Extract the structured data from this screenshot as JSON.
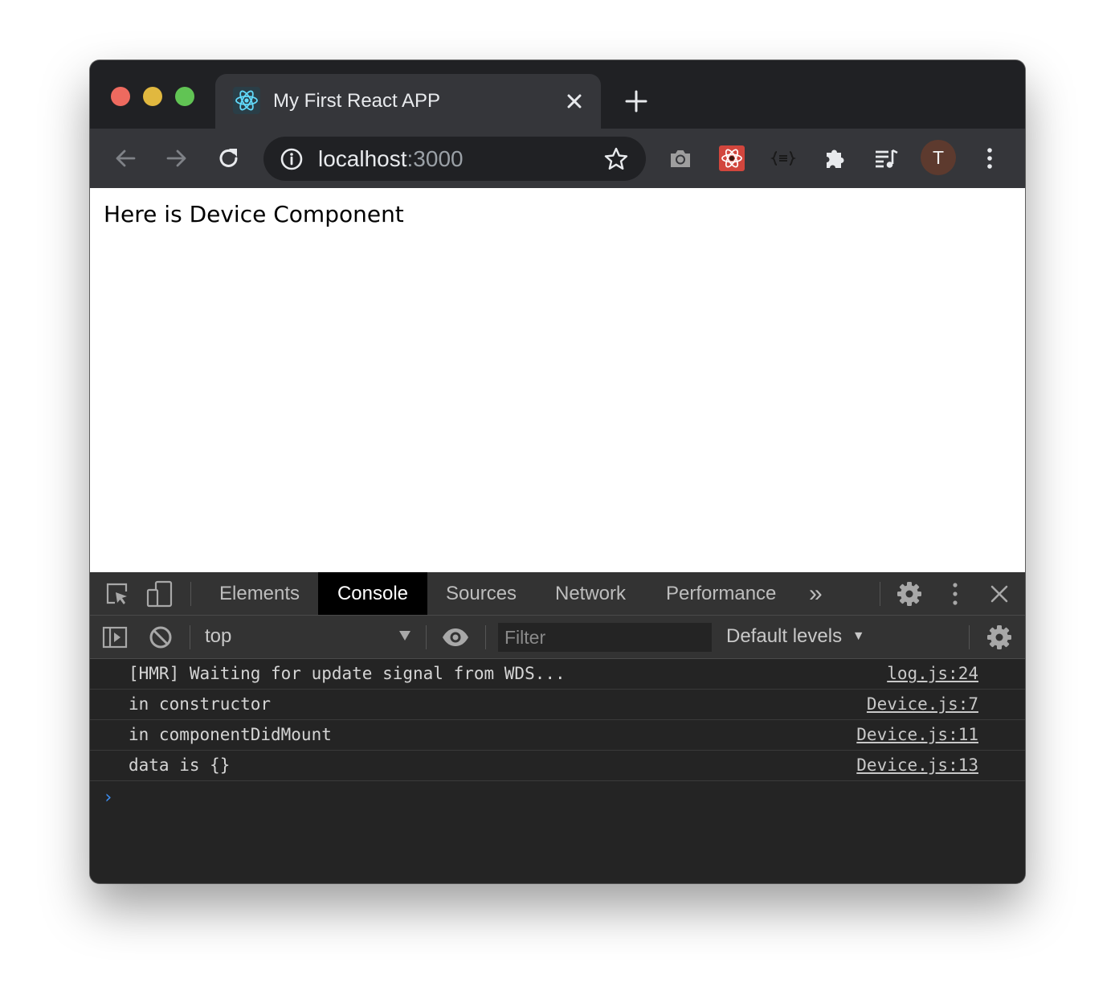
{
  "tab": {
    "title": "My First React APP",
    "favicon": "react-icon"
  },
  "omnibox": {
    "host": "localhost",
    "port": ":3000"
  },
  "profile": {
    "initial": "T"
  },
  "page": {
    "heading": "Here is Device Component"
  },
  "devtools": {
    "tabs": [
      "Elements",
      "Console",
      "Sources",
      "Network",
      "Performance"
    ],
    "active_tab": "Console",
    "more_tabs": "»",
    "context": "top",
    "filter_placeholder": "Filter",
    "levels": "Default levels",
    "logs": [
      {
        "message": "[HMR] Waiting for update signal from WDS...",
        "source": "log.js:24"
      },
      {
        "message": "in constructor",
        "source": "Device.js:7"
      },
      {
        "message": "in componentDidMount",
        "source": "Device.js:11"
      },
      {
        "message": "data is {}",
        "source": "Device.js:13"
      }
    ],
    "prompt": "›"
  },
  "colors": {
    "tab_background": "#35363a",
    "frame_background": "#202124",
    "console_background": "#242424",
    "prompt_blue": "#3d8ef0"
  }
}
